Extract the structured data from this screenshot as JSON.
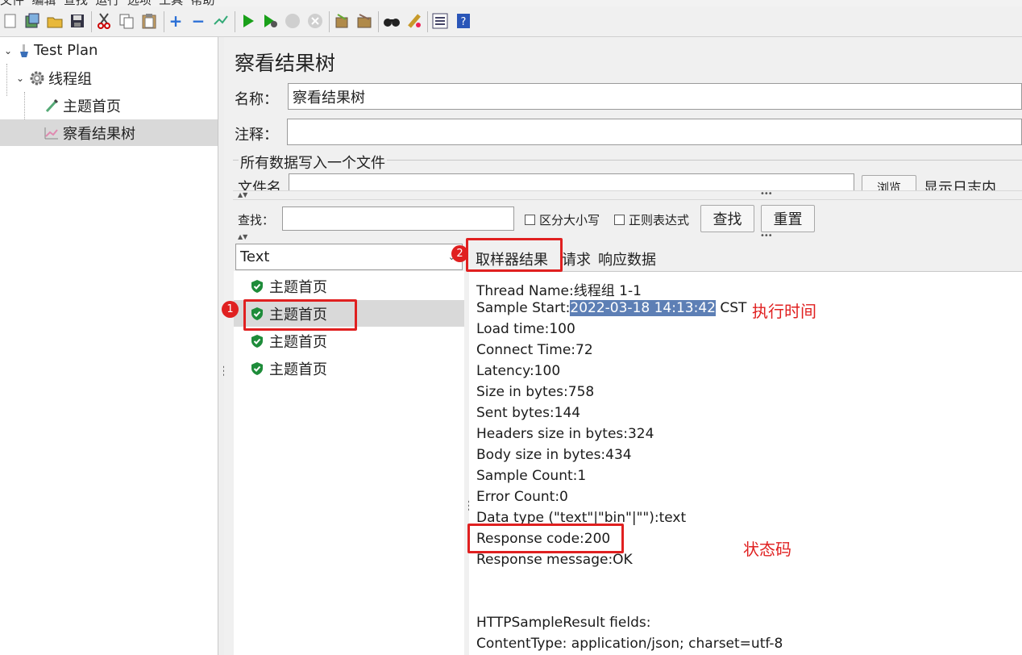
{
  "menubar": {
    "items": [
      "文件",
      "编辑",
      "查找",
      "运行",
      "选项",
      "工具",
      "帮助"
    ]
  },
  "toolbar": {
    "icons": [
      "new-icon",
      "templates-icon",
      "open-icon",
      "save-icon",
      "cut-icon",
      "copy-icon",
      "paste-icon",
      "expand-icon",
      "collapse-icon",
      "toggle-icon",
      "start-icon",
      "start-no-pause-icon",
      "stop-icon",
      "shutdown-icon",
      "clear-icon",
      "clear-all-icon",
      "search-icon",
      "reset-search-icon",
      "function-helper-icon",
      "help-icon"
    ]
  },
  "tree": {
    "items": [
      {
        "label": "Test Plan",
        "icon": "test-plan-icon"
      },
      {
        "label": "线程组",
        "icon": "thread-group-gear-icon"
      },
      {
        "label": "主题首页",
        "icon": "sampler-pipette-icon"
      },
      {
        "label": "察看结果树",
        "icon": "listener-chart-icon"
      }
    ]
  },
  "panel": {
    "title": "察看结果树",
    "name_label": "名称：",
    "name_value": "察看结果树",
    "comment_label": "注释：",
    "comment_value": "",
    "file_section_label": "所有数据写入一个文件",
    "filename_label": "文件名",
    "browse_label": "浏览",
    "log_display_label": "显示日志内容："
  },
  "search": {
    "label": "查找：",
    "value": "",
    "case_sensitive_label": "区分大小写",
    "regex_label": "正则表达式",
    "find_button": "查找",
    "reset_button": "重置"
  },
  "results": {
    "renderer_select": "Text",
    "items": [
      "主题首页",
      "主题首页",
      "主题首页",
      "主题首页"
    ],
    "selected_index": 1
  },
  "detail": {
    "tabs": [
      "取样器结果",
      "请求",
      "响应数据"
    ],
    "lines": [
      "Thread Name:线程组 1-1",
      "Load time:100",
      "Connect Time:72",
      "Latency:100",
      "Size in bytes:758",
      "Sent bytes:144",
      "Headers size in bytes:324",
      "Body size in bytes:434",
      "Sample Count:1",
      "Error Count:0",
      "Data type (\"text\"|\"bin\"|\"\"):text",
      "Response code:200",
      "Response message:OK",
      "HTTPSampleResult fields:",
      "ContentType: application/json; charset=utf-8"
    ],
    "sample_start_prefix": "Sample Start:",
    "sample_start_value": "2022-03-18 14:13:42",
    "sample_start_suffix": " CST"
  },
  "annotations": {
    "badge1": "1",
    "badge2": "2",
    "exec_time": "执行时间",
    "status_code": "状态码",
    "color": "#e02020"
  }
}
